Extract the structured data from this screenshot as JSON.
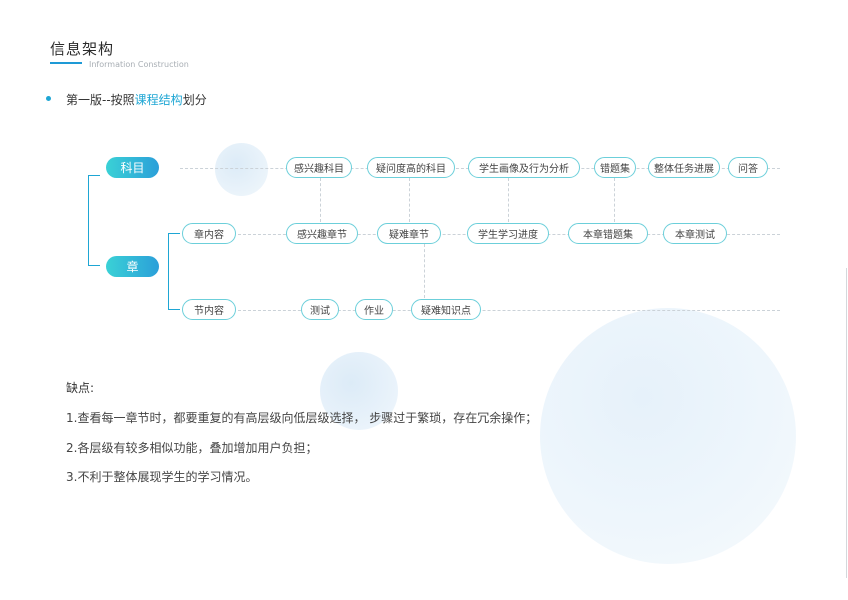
{
  "header": {
    "title": "信息架构",
    "subtitle": "Information Construction"
  },
  "version": {
    "prefix": "第一版--按照",
    "highlight": "课程结构",
    "suffix": "划分"
  },
  "diagram": {
    "level_subject": "科目",
    "level_chapter": "章",
    "subject_row": [
      "感兴趣科目",
      "疑问度高的科目",
      "学生画像及行为分析",
      "错题集",
      "整体任务进展",
      "问答"
    ],
    "chapter_content": "章内容",
    "chapter_row": [
      "感兴趣章节",
      "疑难章节",
      "学生学习进度",
      "本章错题集",
      "本章测试"
    ],
    "section_content": "节内容",
    "section_row": [
      "测试",
      "作业",
      "疑难知识点"
    ]
  },
  "drawbacks": {
    "heading": "缺点:",
    "items": [
      "1.查看每一章节时，都要重复的有高层级向低层级选择， 步骤过于繁琐，存在冗余操作；",
      "2.各层级有较多相似功能，叠加增加用户负担；",
      "3.不利于整体展现学生的学习情况。"
    ]
  },
  "colors": {
    "accent": "#1ea6d4",
    "pill_gradient_start": "#3ad1d6",
    "pill_gradient_end": "#2b9fd9",
    "node_border": "#6ccfda"
  }
}
